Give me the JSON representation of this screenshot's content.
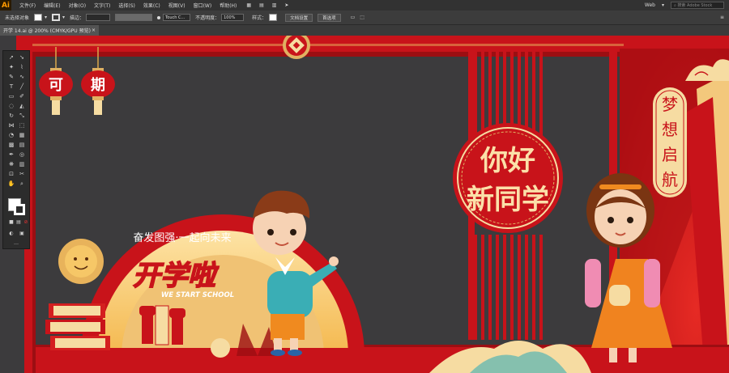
{
  "app": {
    "logo": "Ai"
  },
  "menu": [
    "文件(F)",
    "编辑(E)",
    "对象(O)",
    "文字(T)",
    "选择(S)",
    "效果(C)",
    "视图(V)",
    "窗口(W)",
    "帮助(H)"
  ],
  "menu_right": {
    "workspace": "Web",
    "search_placeholder": "搜索 Adobe Stock"
  },
  "control_bar": {
    "selection": "未选择对象",
    "stroke_label": "描边：",
    "brush": "Touch C...",
    "opacity_label": "不透明度：",
    "opacity_value": "100%",
    "style_label": "样式：",
    "doc_settings": "文档设置",
    "preferences": "首选项"
  },
  "document_tab": {
    "title": "开学 14.ai @ 200% (CMYK/GPU 预览)"
  },
  "artwork": {
    "lanterns": [
      "可",
      "期"
    ],
    "banner_arc": "奋发图强·一起向未来",
    "title": "开学啦",
    "subtitle": "WE START SCHOOL",
    "greeting_line1": "你好",
    "greeting_line2": "新同学",
    "vertical_chars": [
      "梦",
      "想",
      "启",
      "航"
    ]
  },
  "colors": {
    "red": "#c8131a",
    "dark_red": "#9c0e12",
    "cream": "#f6dca2",
    "gold": "#e8b35b",
    "bg": "#3c3b3d"
  }
}
